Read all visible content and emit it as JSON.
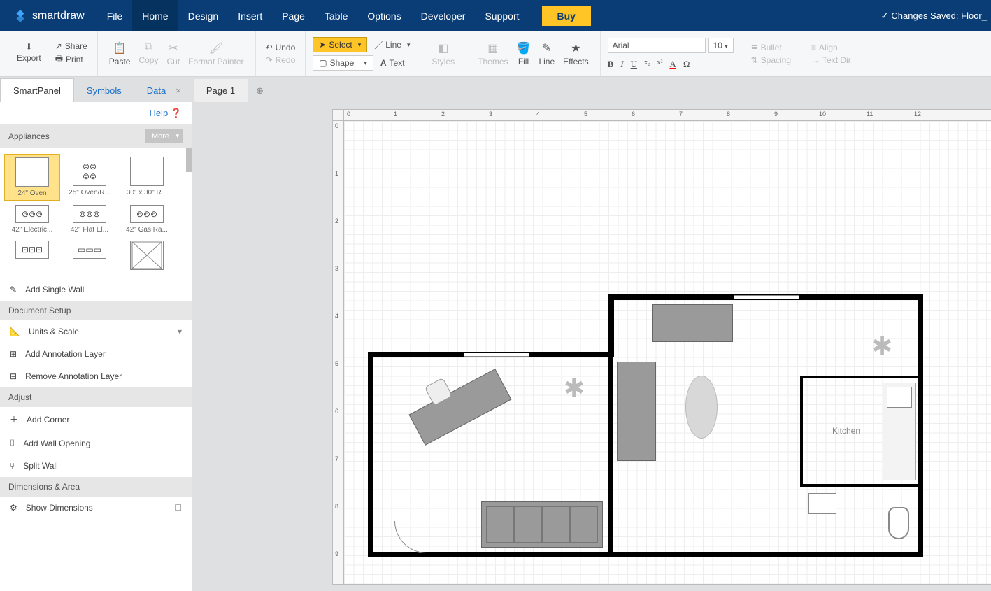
{
  "app": {
    "brand": "smartdraw",
    "save_status": "Changes Saved: Floor_"
  },
  "menu": [
    "File",
    "Home",
    "Design",
    "Insert",
    "Page",
    "Table",
    "Options",
    "Developer",
    "Support"
  ],
  "menu_active_index": 1,
  "buy_label": "Buy",
  "ribbon": {
    "export": "Export",
    "share": "Share",
    "print": "Print",
    "paste": "Paste",
    "copy": "Copy",
    "cut": "Cut",
    "format_painter": "Format Painter",
    "undo": "Undo",
    "redo": "Redo",
    "select": "Select",
    "line": "Line",
    "shape": "Shape",
    "text": "Text",
    "styles": "Styles",
    "themes": "Themes",
    "fill": "Fill",
    "line2": "Line",
    "effects": "Effects",
    "font": "Arial",
    "font_size": "10",
    "bullet": "Bullet",
    "align": "Align",
    "spacing": "Spacing",
    "textdir": "Text Dir"
  },
  "tabs": {
    "smartpanel": "SmartPanel",
    "symbols": "Symbols",
    "data": "Data",
    "page": "Page 1"
  },
  "sidebar": {
    "help": "Help",
    "appliances_hdr": "Appliances",
    "more": "More",
    "symbols": [
      "24\" Oven",
      "25\" Oven/R...",
      "30\" x 30\" R...",
      "42\" Electric...",
      "42\" Flat El...",
      "42\" Gas Ra..."
    ],
    "add_single_wall": "Add Single Wall",
    "doc_setup_hdr": "Document Setup",
    "units_scale": "Units & Scale",
    "add_anno": "Add Annotation Layer",
    "remove_anno": "Remove Annotation Layer",
    "adjust_hdr": "Adjust",
    "add_corner": "Add Corner",
    "add_wall_opening": "Add Wall Opening",
    "split_wall": "Split Wall",
    "dims_hdr": "Dimensions & Area",
    "show_dims": "Show Dimensions"
  },
  "canvas": {
    "h_ticks": [
      "0",
      "1",
      "2",
      "3",
      "4",
      "5",
      "6",
      "7",
      "8",
      "9",
      "10",
      "11",
      "12"
    ],
    "v_ticks": [
      "0",
      "1",
      "2",
      "3",
      "4",
      "5",
      "6",
      "7",
      "8",
      "9"
    ],
    "kitchen_label": "Kitchen"
  }
}
